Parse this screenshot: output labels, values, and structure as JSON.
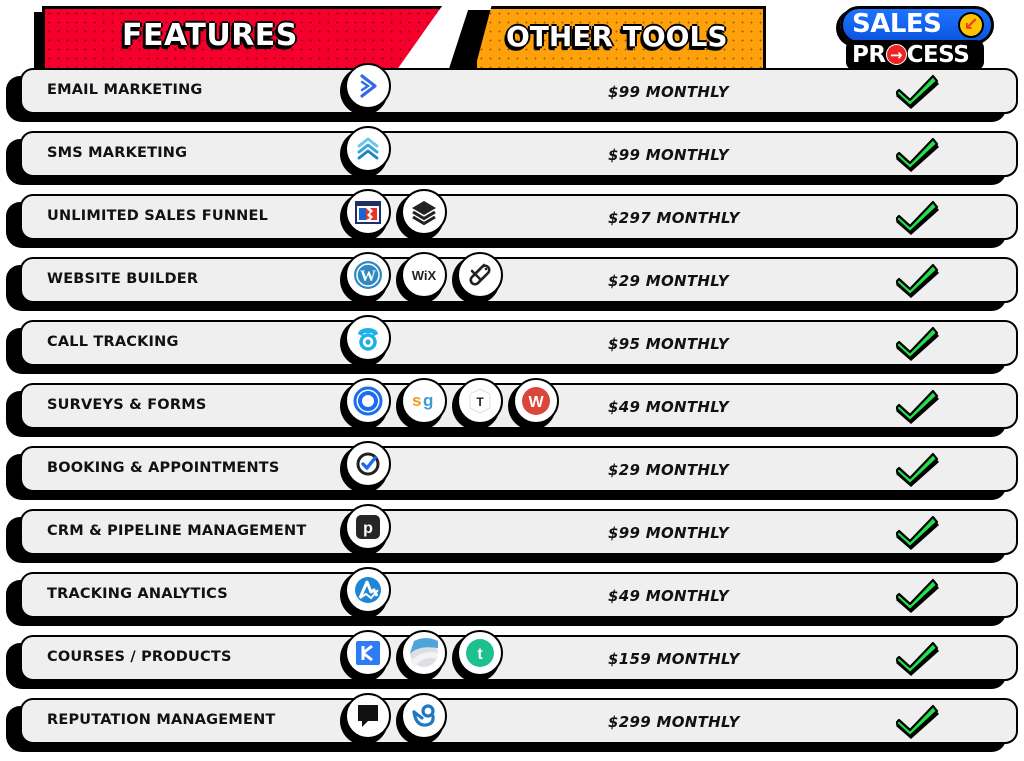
{
  "header": {
    "features_label": "FEATURES",
    "other_tools_label": "OTHER TOOLS",
    "brand": {
      "line1": "SALES",
      "line2_pre": "PR",
      "line2_post": "CESS",
      "badge_icon": "arrow-down-left-icon",
      "o_icon": "arrow-right-icon"
    }
  },
  "colors": {
    "features_banner": "#f5002d",
    "other_tools_banner": "#ffa10a",
    "brand_blue": "#1e74ff",
    "check_green": "#22e04a",
    "row_bg": "#efefef"
  },
  "rows": [
    {
      "feature": "EMAIL MARKETING",
      "tools": [
        "activecampaign-icon"
      ],
      "price": "$99 MONTHLY",
      "included": true
    },
    {
      "feature": "SMS MARKETING",
      "tools": [
        "sms-chevrons-icon"
      ],
      "price": "$99 MONTHLY",
      "included": true
    },
    {
      "feature": "UNLIMITED SALES FUNNEL",
      "tools": [
        "clickfunnels-icon",
        "layers-icon"
      ],
      "price": "$297 MONTHLY",
      "included": true
    },
    {
      "feature": "WEBSITE BUILDER",
      "tools": [
        "wordpress-icon",
        "wix-icon",
        "squarespace-icon"
      ],
      "price": "$29 MONTHLY",
      "included": true
    },
    {
      "feature": "CALL TRACKING",
      "tools": [
        "phone-tracking-icon"
      ],
      "price": "$95 MONTHLY",
      "included": true
    },
    {
      "feature": "SURVEYS & FORMS",
      "tools": [
        "calendly-icon",
        "surveygizmo-icon",
        "typeform-icon",
        "wufoo-icon"
      ],
      "price": "$49 MONTHLY",
      "included": true
    },
    {
      "feature": "BOOKING & APPOINTMENTS",
      "tools": [
        "acuity-check-icon"
      ],
      "price": "$29 MONTHLY",
      "included": true
    },
    {
      "feature": "CRM & PIPELINE MANAGEMENT",
      "tools": [
        "pipedrive-icon"
      ],
      "price": "$99 MONTHLY",
      "included": true
    },
    {
      "feature": "TRACKING ANALYTICS",
      "tools": [
        "analytics-a-icon"
      ],
      "price": "$49 MONTHLY",
      "included": true
    },
    {
      "feature": "COURSES / PRODUCTS",
      "tools": [
        "kajabi-icon",
        "swirl-icon",
        "teachable-icon"
      ],
      "price": "$159 MONTHLY",
      "included": true
    },
    {
      "feature": "REPUTATION MANAGEMENT",
      "tools": [
        "podium-icon",
        "birdeye-icon"
      ],
      "price": "$299 MONTHLY",
      "included": true
    }
  ]
}
